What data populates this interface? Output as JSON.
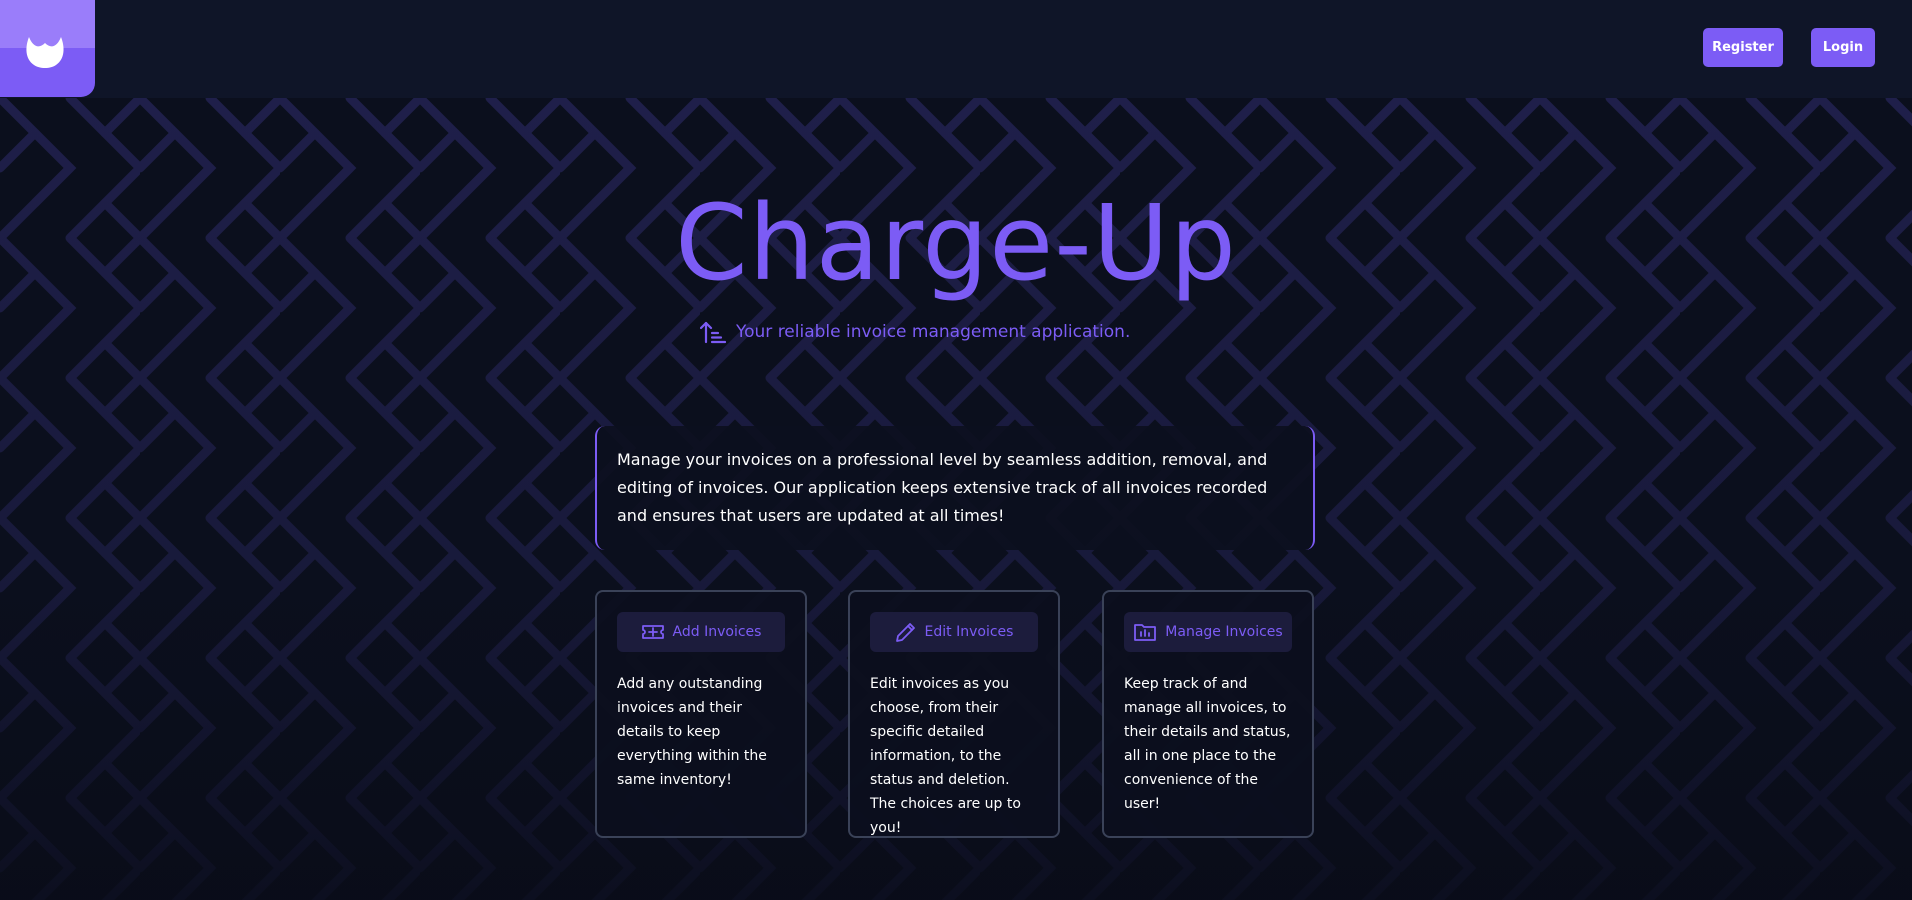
{
  "header": {
    "logo_icon": "flame-drop-icon",
    "register_label": "Register",
    "login_label": "Login"
  },
  "hero": {
    "title": "Charge-Up",
    "tagline_icon": "sort-ascending-icon",
    "tagline": "Your reliable invoice management application."
  },
  "intro": {
    "text": "Manage your invoices on a professional level by seamless addition, removal, and editing of invoices. Our application keeps extensive track of all invoices recorded and ensures that users are updated at all times!"
  },
  "features": [
    {
      "icon": "ticket-icon",
      "label": "Add Invoices",
      "text": "Add any outstanding invoices and their details to keep everything within the same inventory!"
    },
    {
      "icon": "pencil-icon",
      "label": "Edit Invoices",
      "text": "Edit invoices as you choose, from their specific detailed information, to the status and deletion. The choices are up to you!"
    },
    {
      "icon": "folder-chart-icon",
      "label": "Manage Invoices",
      "text": "Keep track of and manage all invoices, to their details and status, all in one place to the convenience of the user!"
    }
  ],
  "colors": {
    "accent": "#7c5cf5",
    "accent_light": "#9a7dfa",
    "background": "#0b0f1d",
    "header_bg": "#0f1528",
    "pattern": "#1f1f4a",
    "card_border": "#3a4258",
    "label_bg": "#1c1c3c"
  }
}
